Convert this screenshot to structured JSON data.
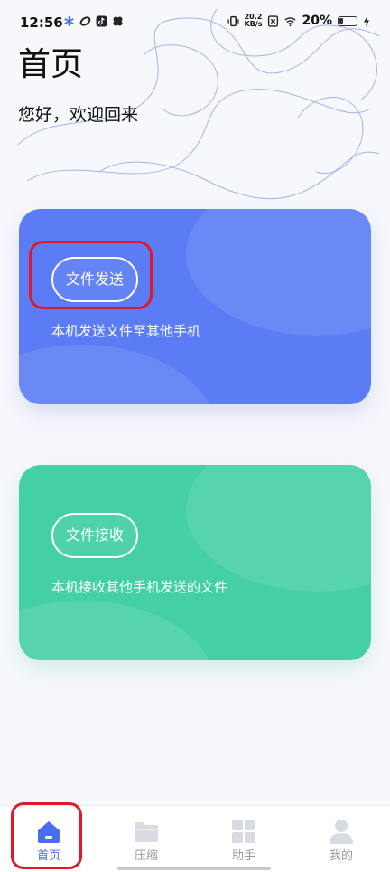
{
  "status": {
    "time": "12:56",
    "net_speed_value": "20.2",
    "net_speed_unit": "KB/s",
    "battery": "20%"
  },
  "page": {
    "title": "首页",
    "greeting": "您好，欢迎回来"
  },
  "cards": {
    "send": {
      "button": "文件发送",
      "description": "本机发送文件至其他手机",
      "color": "#5b7cf4"
    },
    "receive": {
      "button": "文件接收",
      "description": "本机接收其他手机发送的文件",
      "color": "#44cfa4"
    }
  },
  "tabs": [
    {
      "label": "首页",
      "icon": "home-icon",
      "active": true
    },
    {
      "label": "压缩",
      "icon": "folder-icon",
      "active": false
    },
    {
      "label": "助手",
      "icon": "grid-icon",
      "active": false
    },
    {
      "label": "我的",
      "icon": "person-icon",
      "active": false
    }
  ],
  "colors": {
    "accent": "#4a6cf0",
    "highlight": "#e0182c",
    "inactive_tab": "#9a9aa2"
  }
}
